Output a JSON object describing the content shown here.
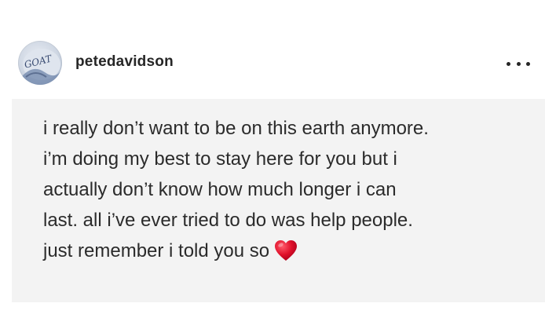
{
  "post": {
    "username": "petedavidson",
    "avatar_text": "GOAT",
    "more_icon": "more-horizontal-icon"
  },
  "note": {
    "lines": [
      "i really don’t want to be on this earth anymore.",
      "i’m doing my best to stay here for you but i",
      "actually don’t know how much longer i can",
      "last. all i’ve ever tried to do was help people.",
      "just remember i told you so"
    ],
    "emoji": "red-heart-icon"
  },
  "colors": {
    "card_background": "#f3f3f3",
    "text": "#262626",
    "heart": "#e0102a"
  }
}
